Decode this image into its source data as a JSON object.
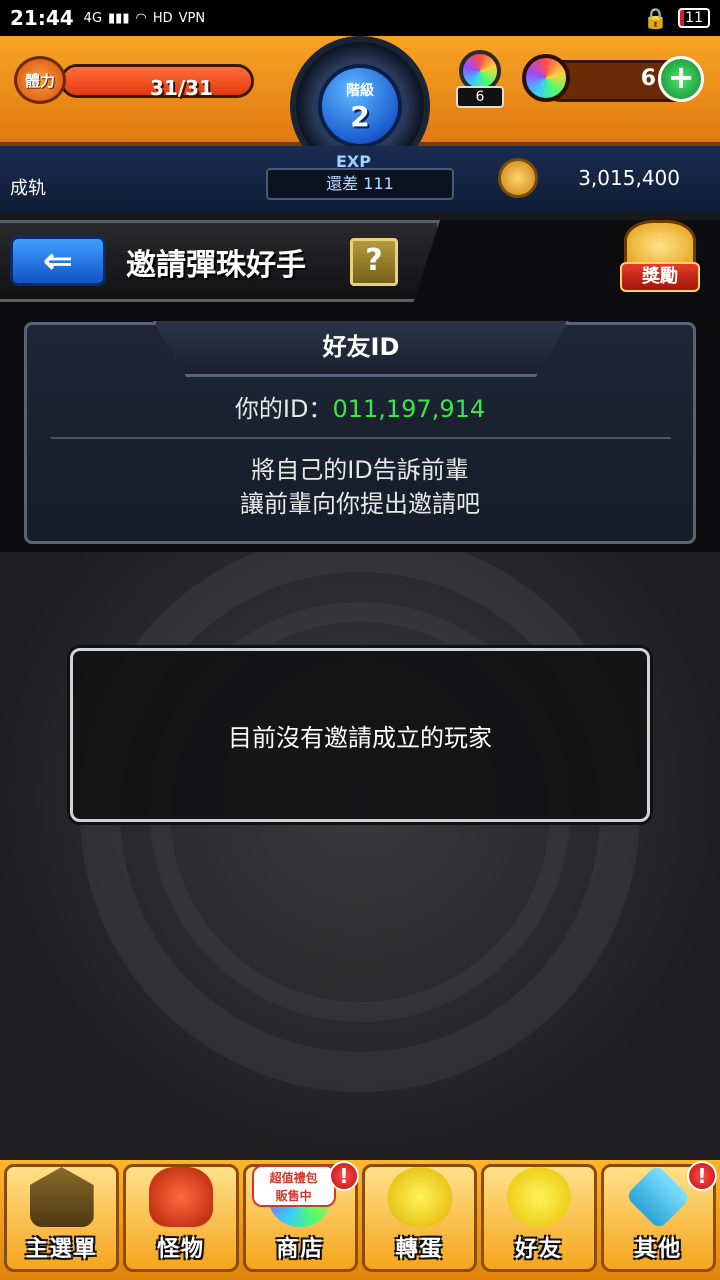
{
  "status_bar": {
    "time": "21:44",
    "network_label": "4G",
    "hd_label": "HD",
    "vpn_label": "VPN",
    "battery": "11"
  },
  "header": {
    "stamina_label": "體力",
    "stamina_value": "31/31",
    "stamina_fraction": 1.0,
    "rank_label": "階級",
    "rank_value": "2",
    "gacha_count": "6",
    "orb_count": "6",
    "plus_symbol": "+"
  },
  "info": {
    "player_name": "成轨",
    "exp_label": "EXP",
    "exp_remaining": "還差 111",
    "coins": "3,015,400"
  },
  "title": {
    "back_symbol": "⇐",
    "screen_title": "邀請彈珠好手",
    "help_symbol": "?",
    "reward_label": "獎勵"
  },
  "friend_id_panel": {
    "title": "好友ID",
    "id_prefix": "你的ID：",
    "id_value": "011,197,914",
    "desc_line1": "將自己的ID告訴前輩",
    "desc_line2": "讓前輩向你提出邀請吧"
  },
  "invite_status": {
    "message": "目前沒有邀請成立的玩家"
  },
  "bottom_nav": {
    "items": [
      {
        "label": "主選單",
        "icon": "castle-icon"
      },
      {
        "label": "怪物",
        "icon": "monster-icon"
      },
      {
        "label": "商店",
        "icon": "orb-shop-icon"
      },
      {
        "label": "轉蛋",
        "icon": "egg-icon"
      },
      {
        "label": "好友",
        "icon": "friends-icon"
      },
      {
        "label": "其他",
        "icon": "other-icon"
      }
    ],
    "shop_sale_line1": "超值禮包",
    "shop_sale_line2": "販售中",
    "alert_symbol": "!"
  },
  "colors": {
    "header_orange": "#f7a325",
    "id_green": "#38e84a",
    "navy": "#1a2c50"
  }
}
